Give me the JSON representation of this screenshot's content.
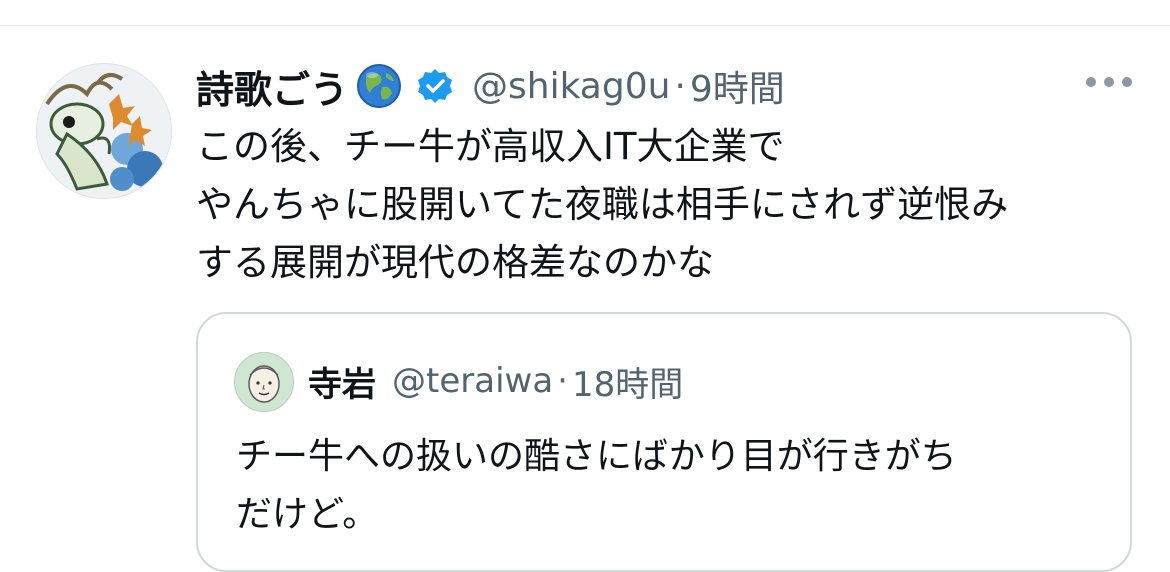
{
  "tweet": {
    "display_name": "詩歌ごう",
    "handle": "@shikag0u",
    "separator": "·",
    "time": "9時間",
    "text_lines": [
      "この後、チー牛が高収入IT大企業で",
      "やんちゃに股開いてた夜職は相手にされず逆恨み",
      "する展開が現代の格差なのかな"
    ],
    "avatar_icon": "illustrated-avatar",
    "globe_icon": "earth-globe-emoji",
    "verified_icon": "verified-badge",
    "more_icon": "more-horizontal-icon"
  },
  "quoted_tweet": {
    "display_name": "寺岩",
    "handle": "@teraiwa",
    "separator": "·",
    "time": "18時間",
    "text_lines": [
      "チー牛への扱いの酷さにばかり目が行きがち",
      "だけど。"
    ],
    "avatar_icon": "cartoon-face-avatar"
  },
  "colors": {
    "text": "#0f1419",
    "secondary_text": "#536471",
    "verified_blue": "#1d9bf0",
    "border": "#cfd9de"
  }
}
